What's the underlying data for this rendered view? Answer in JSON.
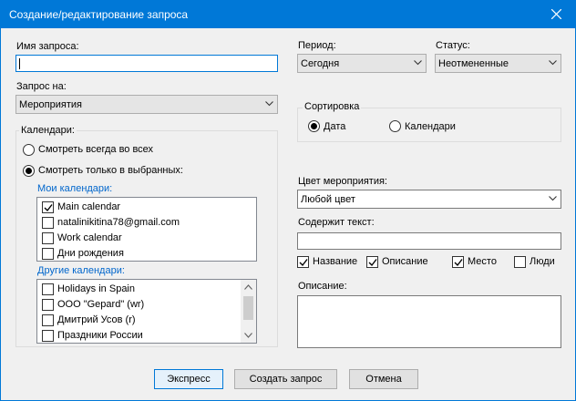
{
  "window": {
    "title": "Создание/редактирование запроса"
  },
  "left": {
    "query_name_label": "Имя запроса:",
    "query_name_value": "",
    "query_on_label": "Запрос на:",
    "query_on_value": "Мероприятия",
    "calendars_group": "Календари:",
    "radio_all": "Смотреть всегда во всех",
    "radio_selected": "Смотреть только в выбранных:",
    "my_calendars_label": "Мои календари:",
    "my_calendars": [
      {
        "label": "Main calendar",
        "checked": true
      },
      {
        "label": "natalinikitina78@gmail.com",
        "checked": false
      },
      {
        "label": "Work calendar",
        "checked": false
      },
      {
        "label": "Дни рождения",
        "checked": false
      }
    ],
    "other_calendars_label": "Другие календари:",
    "other_calendars": [
      {
        "label": "Holidays in Spain",
        "checked": false
      },
      {
        "label": "ООО \"Gepard\" (wr)",
        "checked": false
      },
      {
        "label": "Дмитрий Усов (r)",
        "checked": false
      },
      {
        "label": "Праздники России",
        "checked": false
      }
    ]
  },
  "right": {
    "period_label": "Период:",
    "period_value": "Сегодня",
    "status_label": "Статус:",
    "status_value": "Неотмененные",
    "sort_group": "Сортировка",
    "sort_date": "Дата",
    "sort_calendars": "Календари",
    "event_color_label": "Цвет мероприятия:",
    "event_color_value": "Любой цвет",
    "contains_text_label": "Содержит текст:",
    "contains_text_value": "",
    "search_in": [
      {
        "label": "Название",
        "checked": true
      },
      {
        "label": "Описание",
        "checked": true
      },
      {
        "label": "Место",
        "checked": true
      },
      {
        "label": "Люди",
        "checked": false
      }
    ],
    "description_label": "Описание:",
    "description_value": ""
  },
  "buttons": {
    "express": "Экспресс",
    "create": "Создать запрос",
    "cancel": "Отмена"
  }
}
